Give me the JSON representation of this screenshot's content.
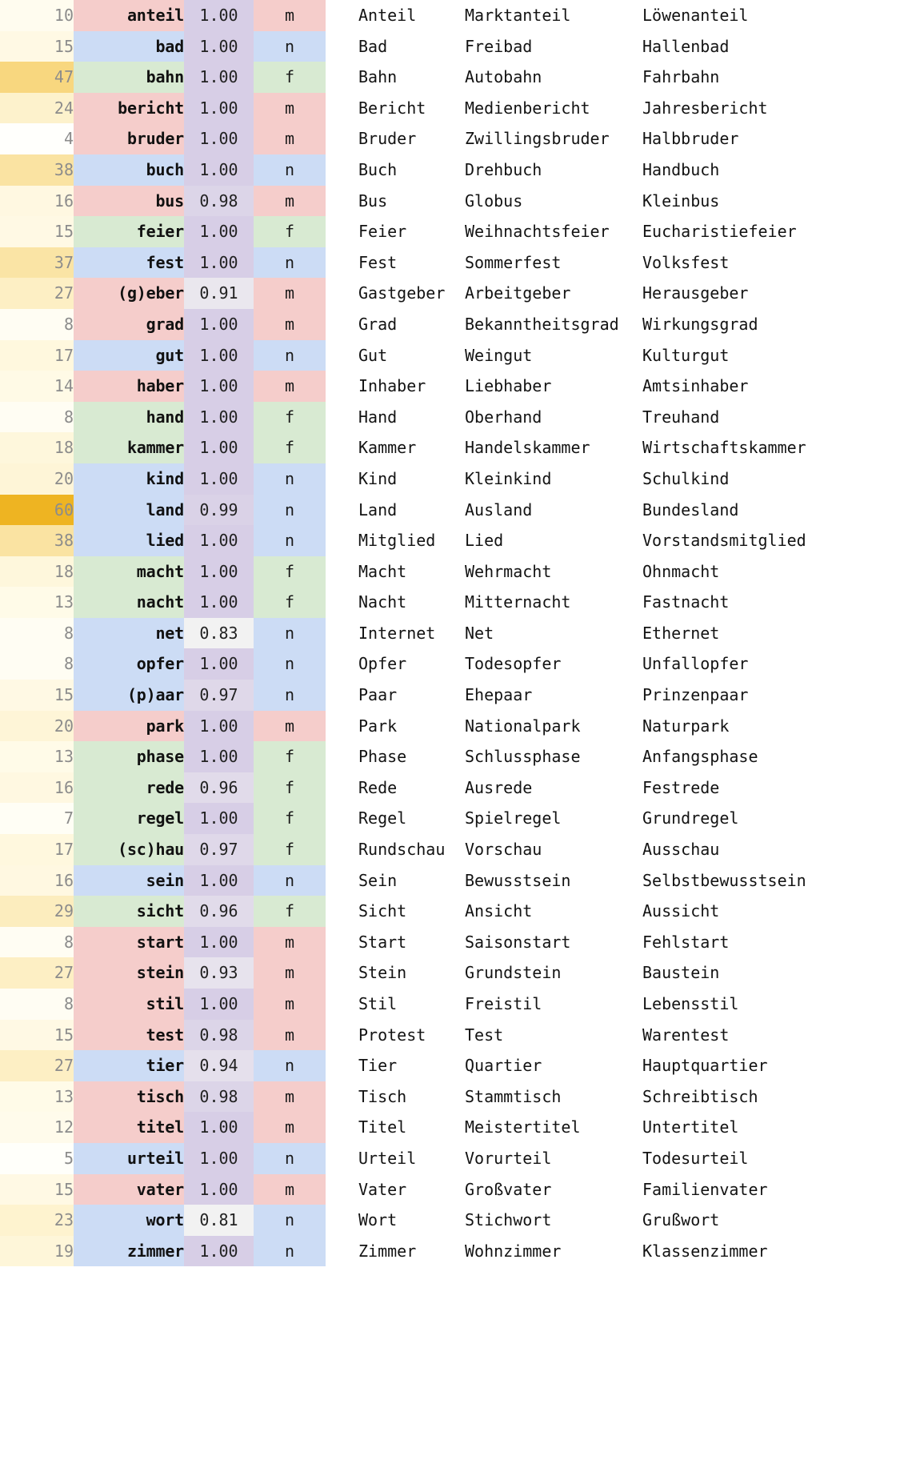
{
  "meta": {
    "columns": [
      "count",
      "head",
      "score",
      "gender",
      "lemma",
      "example_1",
      "example_2"
    ],
    "colors": {
      "gender_m": "#f5cdcb",
      "gender_f": "#d8ead2",
      "gender_n": "#ccdcf5",
      "score_high": "#d7cee6",
      "score_low": "#f2f2f2",
      "count_high": "#eeb422",
      "count_low": "#ffffff",
      "count_text": "#8c8c8c",
      "word_text": "#111111",
      "page_background": "#ffffff"
    },
    "count_min": 4,
    "count_max": 60,
    "score_min": 0.81,
    "score_max": 1.0
  },
  "rows": [
    {
      "count": "10",
      "head": "anteil",
      "score": "1.00",
      "gender": "m",
      "lemma": "Anteil",
      "ex1": "Marktanteil",
      "ex2": "Löwenanteil",
      "count_n": 10,
      "score_n": 1.0
    },
    {
      "count": "15",
      "head": "bad",
      "score": "1.00",
      "gender": "n",
      "lemma": "Bad",
      "ex1": "Freibad",
      "ex2": "Hallenbad",
      "count_n": 15,
      "score_n": 1.0
    },
    {
      "count": "47",
      "head": "bahn",
      "score": "1.00",
      "gender": "f",
      "lemma": "Bahn",
      "ex1": "Autobahn",
      "ex2": "Fahrbahn",
      "count_n": 47,
      "score_n": 1.0
    },
    {
      "count": "24",
      "head": "bericht",
      "score": "1.00",
      "gender": "m",
      "lemma": "Bericht",
      "ex1": "Medienbericht",
      "ex2": "Jahresbericht",
      "count_n": 24,
      "score_n": 1.0
    },
    {
      "count": "4",
      "head": "bruder",
      "score": "1.00",
      "gender": "m",
      "lemma": "Bruder",
      "ex1": "Zwillingsbruder",
      "ex2": "Halbbruder",
      "count_n": 4,
      "score_n": 1.0
    },
    {
      "count": "38",
      "head": "buch",
      "score": "1.00",
      "gender": "n",
      "lemma": "Buch",
      "ex1": "Drehbuch",
      "ex2": "Handbuch",
      "count_n": 38,
      "score_n": 1.0
    },
    {
      "count": "16",
      "head": "bus",
      "score": "0.98",
      "gender": "m",
      "lemma": "Bus",
      "ex1": "Globus",
      "ex2": "Kleinbus",
      "count_n": 16,
      "score_n": 0.98
    },
    {
      "count": "15",
      "head": "feier",
      "score": "1.00",
      "gender": "f",
      "lemma": "Feier",
      "ex1": "Weihnachtsfeier",
      "ex2": "Eucharistiefeier",
      "count_n": 15,
      "score_n": 1.0
    },
    {
      "count": "37",
      "head": "fest",
      "score": "1.00",
      "gender": "n",
      "lemma": "Fest",
      "ex1": "Sommerfest",
      "ex2": "Volksfest",
      "count_n": 37,
      "score_n": 1.0
    },
    {
      "count": "27",
      "head": "(g)eber",
      "score": "0.91",
      "gender": "m",
      "lemma": "Gastgeber",
      "ex1": "Arbeitgeber",
      "ex2": "Herausgeber",
      "count_n": 27,
      "score_n": 0.91
    },
    {
      "count": "8",
      "head": "grad",
      "score": "1.00",
      "gender": "m",
      "lemma": "Grad",
      "ex1": "Bekanntheitsgrad",
      "ex2": "Wirkungsgrad",
      "count_n": 8,
      "score_n": 1.0
    },
    {
      "count": "17",
      "head": "gut",
      "score": "1.00",
      "gender": "n",
      "lemma": "Gut",
      "ex1": "Weingut",
      "ex2": "Kulturgut",
      "count_n": 17,
      "score_n": 1.0
    },
    {
      "count": "14",
      "head": "haber",
      "score": "1.00",
      "gender": "m",
      "lemma": "Inhaber",
      "ex1": "Liebhaber",
      "ex2": "Amtsinhaber",
      "count_n": 14,
      "score_n": 1.0
    },
    {
      "count": "8",
      "head": "hand",
      "score": "1.00",
      "gender": "f",
      "lemma": "Hand",
      "ex1": "Oberhand",
      "ex2": "Treuhand",
      "count_n": 8,
      "score_n": 1.0
    },
    {
      "count": "18",
      "head": "kammer",
      "score": "1.00",
      "gender": "f",
      "lemma": "Kammer",
      "ex1": "Handelskammer",
      "ex2": "Wirtschaftskammer",
      "count_n": 18,
      "score_n": 1.0
    },
    {
      "count": "20",
      "head": "kind",
      "score": "1.00",
      "gender": "n",
      "lemma": "Kind",
      "ex1": "Kleinkind",
      "ex2": "Schulkind",
      "count_n": 20,
      "score_n": 1.0
    },
    {
      "count": "60",
      "head": "land",
      "score": "0.99",
      "gender": "n",
      "lemma": "Land",
      "ex1": "Ausland",
      "ex2": "Bundesland",
      "count_n": 60,
      "score_n": 0.99
    },
    {
      "count": "38",
      "head": "lied",
      "score": "1.00",
      "gender": "n",
      "lemma": "Mitglied",
      "ex1": "Lied",
      "ex2": "Vorstandsmitglied",
      "count_n": 38,
      "score_n": 1.0
    },
    {
      "count": "18",
      "head": "macht",
      "score": "1.00",
      "gender": "f",
      "lemma": "Macht",
      "ex1": "Wehrmacht",
      "ex2": "Ohnmacht",
      "count_n": 18,
      "score_n": 1.0
    },
    {
      "count": "13",
      "head": "nacht",
      "score": "1.00",
      "gender": "f",
      "lemma": "Nacht",
      "ex1": "Mitternacht",
      "ex2": "Fastnacht",
      "count_n": 13,
      "score_n": 1.0
    },
    {
      "count": "8",
      "head": "net",
      "score": "0.83",
      "gender": "n",
      "lemma": "Internet",
      "ex1": "Net",
      "ex2": "Ethernet",
      "count_n": 8,
      "score_n": 0.83
    },
    {
      "count": "8",
      "head": "opfer",
      "score": "1.00",
      "gender": "n",
      "lemma": "Opfer",
      "ex1": "Todesopfer",
      "ex2": "Unfallopfer",
      "count_n": 8,
      "score_n": 1.0
    },
    {
      "count": "15",
      "head": "(p)aar",
      "score": "0.97",
      "gender": "n",
      "lemma": "Paar",
      "ex1": "Ehepaar",
      "ex2": "Prinzenpaar",
      "count_n": 15,
      "score_n": 0.97
    },
    {
      "count": "20",
      "head": "park",
      "score": "1.00",
      "gender": "m",
      "lemma": "Park",
      "ex1": "Nationalpark",
      "ex2": "Naturpark",
      "count_n": 20,
      "score_n": 1.0
    },
    {
      "count": "13",
      "head": "phase",
      "score": "1.00",
      "gender": "f",
      "lemma": "Phase",
      "ex1": "Schlussphase",
      "ex2": "Anfangsphase",
      "count_n": 13,
      "score_n": 1.0
    },
    {
      "count": "16",
      "head": "rede",
      "score": "0.96",
      "gender": "f",
      "lemma": "Rede",
      "ex1": "Ausrede",
      "ex2": "Festrede",
      "count_n": 16,
      "score_n": 0.96
    },
    {
      "count": "7",
      "head": "regel",
      "score": "1.00",
      "gender": "f",
      "lemma": "Regel",
      "ex1": "Spielregel",
      "ex2": "Grundregel",
      "count_n": 7,
      "score_n": 1.0
    },
    {
      "count": "17",
      "head": "(sc)hau",
      "score": "0.97",
      "gender": "f",
      "lemma": "Rundschau",
      "ex1": "Vorschau",
      "ex2": "Ausschau",
      "count_n": 17,
      "score_n": 0.97
    },
    {
      "count": "16",
      "head": "sein",
      "score": "1.00",
      "gender": "n",
      "lemma": "Sein",
      "ex1": "Bewusstsein",
      "ex2": "Selbstbewusstsein",
      "count_n": 16,
      "score_n": 1.0
    },
    {
      "count": "29",
      "head": "sicht",
      "score": "0.96",
      "gender": "f",
      "lemma": "Sicht",
      "ex1": "Ansicht",
      "ex2": "Aussicht",
      "count_n": 29,
      "score_n": 0.96
    },
    {
      "count": "8",
      "head": "start",
      "score": "1.00",
      "gender": "m",
      "lemma": "Start",
      "ex1": "Saisonstart",
      "ex2": "Fehlstart",
      "count_n": 8,
      "score_n": 1.0
    },
    {
      "count": "27",
      "head": "stein",
      "score": "0.93",
      "gender": "m",
      "lemma": "Stein",
      "ex1": "Grundstein",
      "ex2": "Baustein",
      "count_n": 27,
      "score_n": 0.93
    },
    {
      "count": "8",
      "head": "stil",
      "score": "1.00",
      "gender": "m",
      "lemma": "Stil",
      "ex1": "Freistil",
      "ex2": "Lebensstil",
      "count_n": 8,
      "score_n": 1.0
    },
    {
      "count": "15",
      "head": "test",
      "score": "0.98",
      "gender": "m",
      "lemma": "Protest",
      "ex1": "Test",
      "ex2": "Warentest",
      "count_n": 15,
      "score_n": 0.98
    },
    {
      "count": "27",
      "head": "tier",
      "score": "0.94",
      "gender": "n",
      "lemma": "Tier",
      "ex1": "Quartier",
      "ex2": "Hauptquartier",
      "count_n": 27,
      "score_n": 0.94
    },
    {
      "count": "13",
      "head": "tisch",
      "score": "0.98",
      "gender": "m",
      "lemma": "Tisch",
      "ex1": "Stammtisch",
      "ex2": "Schreibtisch",
      "count_n": 13,
      "score_n": 0.98
    },
    {
      "count": "12",
      "head": "titel",
      "score": "1.00",
      "gender": "m",
      "lemma": "Titel",
      "ex1": "Meistertitel",
      "ex2": "Untertitel",
      "count_n": 12,
      "score_n": 1.0
    },
    {
      "count": "5",
      "head": "urteil",
      "score": "1.00",
      "gender": "n",
      "lemma": "Urteil",
      "ex1": "Vorurteil",
      "ex2": "Todesurteil",
      "count_n": 5,
      "score_n": 1.0
    },
    {
      "count": "15",
      "head": "vater",
      "score": "1.00",
      "gender": "m",
      "lemma": "Vater",
      "ex1": "Großvater",
      "ex2": "Familienvater",
      "count_n": 15,
      "score_n": 1.0
    },
    {
      "count": "23",
      "head": "wort",
      "score": "0.81",
      "gender": "n",
      "lemma": "Wort",
      "ex1": "Stichwort",
      "ex2": "Grußwort",
      "count_n": 23,
      "score_n": 0.81
    },
    {
      "count": "19",
      "head": "zimmer",
      "score": "1.00",
      "gender": "n",
      "lemma": "Zimmer",
      "ex1": "Wohnzimmer",
      "ex2": "Klassenzimmer",
      "count_n": 19,
      "score_n": 1.0
    }
  ]
}
